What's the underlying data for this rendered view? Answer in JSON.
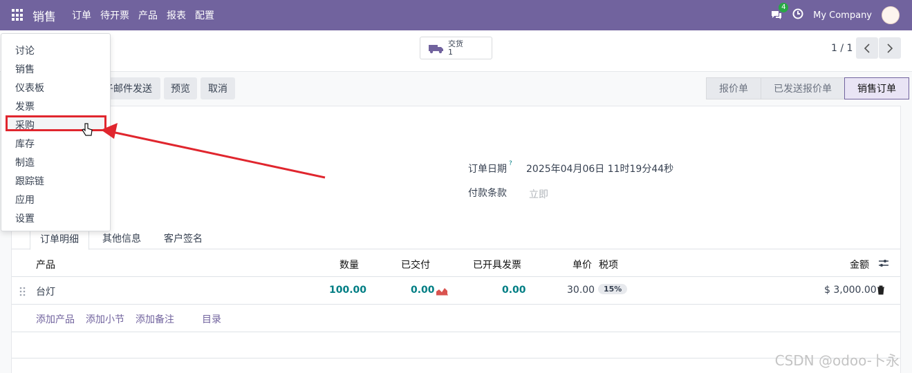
{
  "topbar": {
    "app_name": "销售",
    "menu": [
      "订单",
      "待开票",
      "产品",
      "报表",
      "配置"
    ],
    "chat_count": "4",
    "company": "My Company"
  },
  "controlbar": {
    "delivery_label": "交货",
    "delivery_count": "1",
    "pager": "1 / 1"
  },
  "actions": {
    "email_partial": "子邮件发送",
    "preview": "预览",
    "cancel": "取消"
  },
  "statusbar": [
    "报价单",
    "已发送报价单",
    "销售订单"
  ],
  "form": {
    "order_date_label": "订单日期",
    "order_date_help": "?",
    "order_date_value": "2025年04月06日 11时19分44秒",
    "payment_terms_label": "付款条款",
    "payment_terms_placeholder": "立即"
  },
  "tabs": [
    "订单明细",
    "其他信息",
    "客户签名"
  ],
  "table": {
    "headers": [
      "产品",
      "数量",
      "已交付",
      "已开具发票",
      "单价",
      "税项",
      "金额"
    ],
    "rows": [
      {
        "product": "台灯",
        "qty": "100.00",
        "delivered": "0.00",
        "invoiced": "0.00",
        "unit_price": "30.00",
        "tax": "15%",
        "amount": "$ 3,000.00"
      }
    ],
    "add_links": [
      "添加产品",
      "添加小节",
      "添加备注",
      "目录"
    ]
  },
  "dropdown": [
    "讨论",
    "销售",
    "仪表板",
    "发票",
    "采购",
    "库存",
    "制造",
    "跟踪链",
    "应用",
    "设置"
  ],
  "watermark": "CSDN @odoo-卜永",
  "colors": {
    "brand": "#71639e",
    "link": "#017e84",
    "highlight": "#e0262e"
  }
}
